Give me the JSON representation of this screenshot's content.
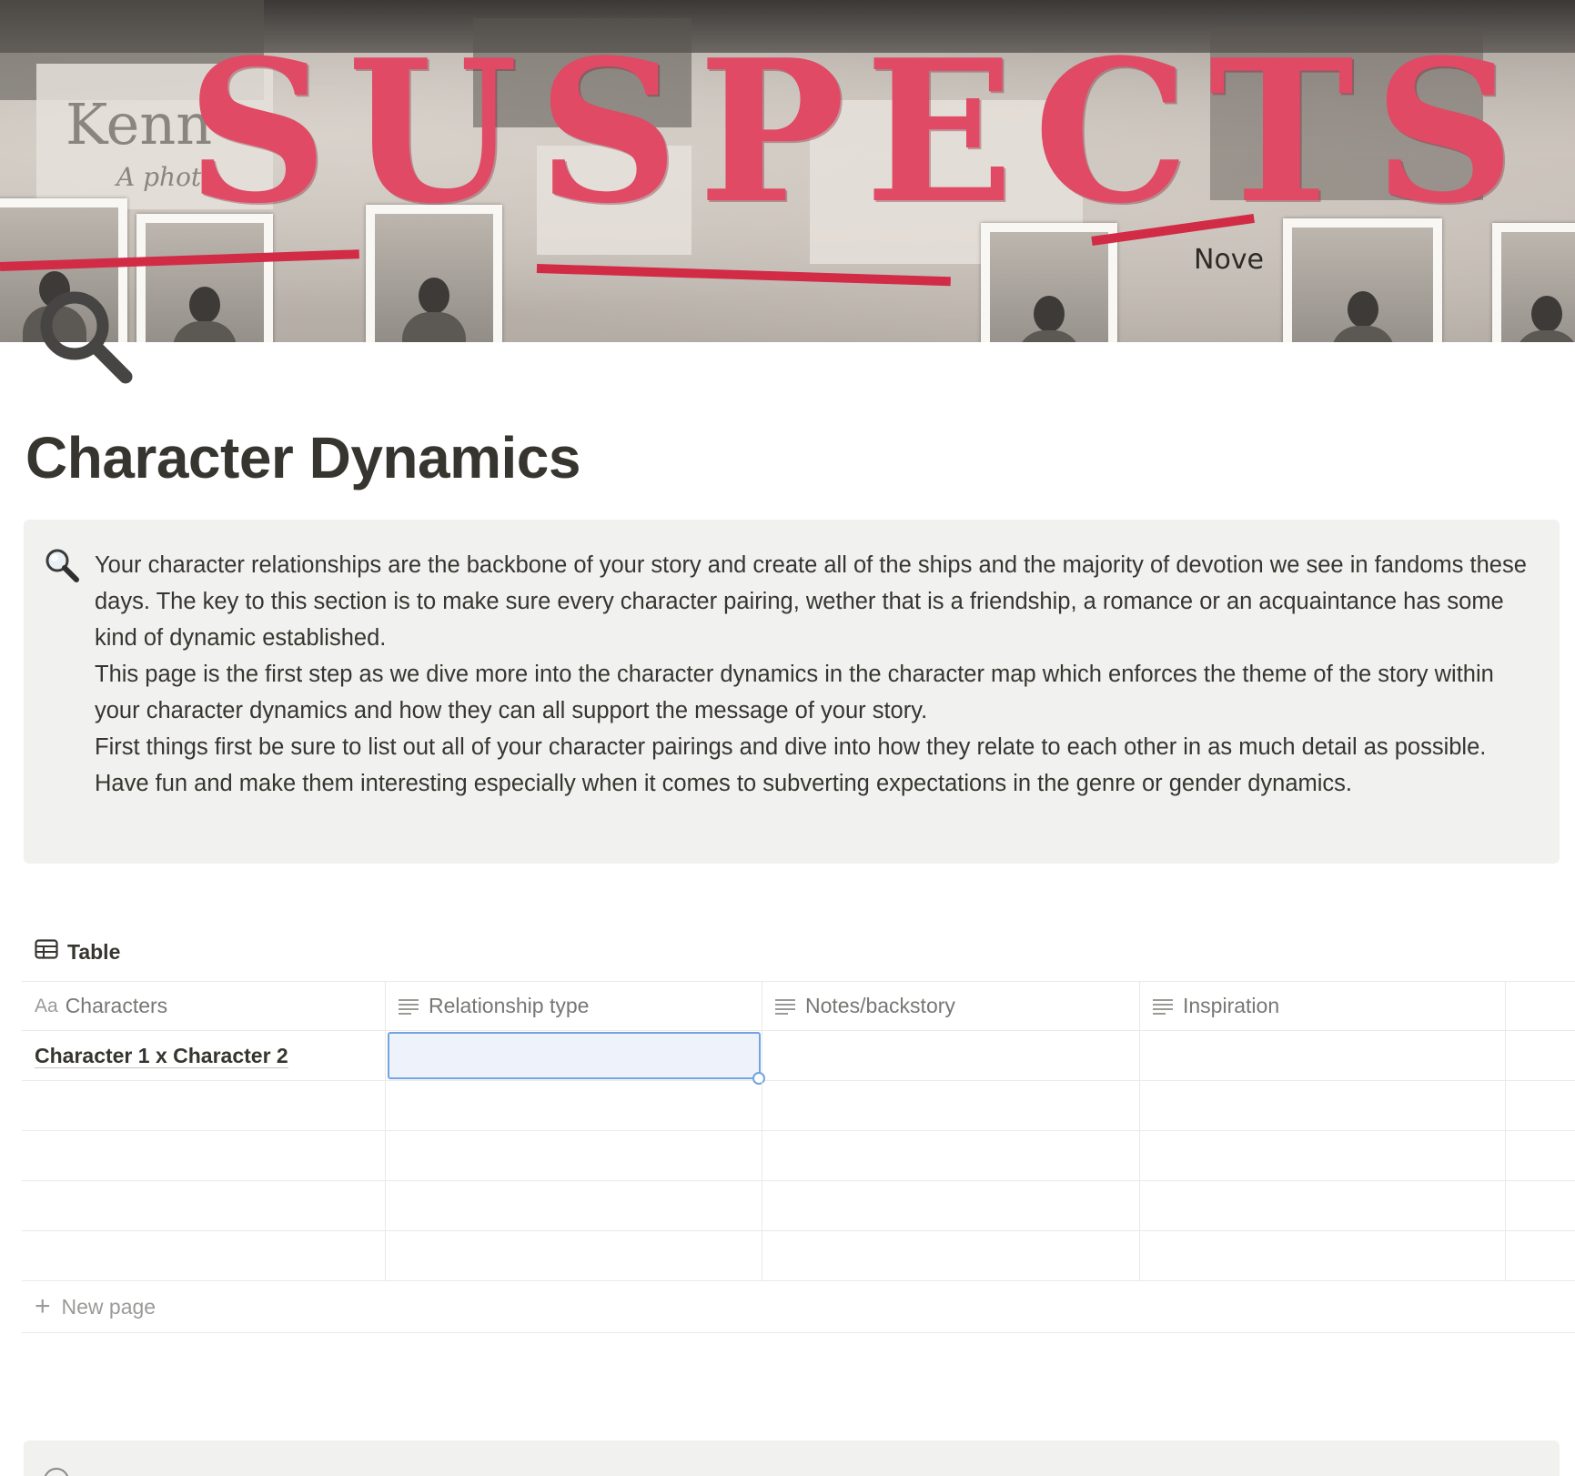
{
  "cover": {
    "headline_letters": [
      "S",
      "U",
      "S",
      "P",
      "E",
      "C",
      "T",
      "S"
    ],
    "scrap_texts": [
      "Kenn",
      "A photo",
      "Nove"
    ],
    "accent_color": "#e04a64",
    "string_color": "#d22b45"
  },
  "page": {
    "icon": "magnifying-glass-icon",
    "title": "Character Dynamics"
  },
  "callout": {
    "icon": "magnifying-glass-tilted-icon",
    "paragraphs": [
      "Your character relationships are the backbone of your story and create all of the ships and the majority of devotion we see in fandoms these days. The key to this section is to make sure every character pairing, wether that is a friendship, a romance or an acquaintance has some kind of dynamic established.",
      "This page is the first step as we dive more into the character dynamics in the character map which enforces the theme of the story within your character dynamics and how they can all support the message of your story.",
      "First things first be sure to list out all of your character pairings and dive into how they relate to each other in as much detail as possible. Have fun and make them interesting especially when it comes to subverting expectations in the genre or gender dynamics."
    ]
  },
  "database": {
    "view_label": "Table",
    "title_prefix": "Aa",
    "columns": [
      {
        "label": "Characters",
        "icon": "title-property-icon"
      },
      {
        "label": "Relationship type",
        "icon": "text-property-icon"
      },
      {
        "label": "Notes/backstory",
        "icon": "text-property-icon"
      },
      {
        "label": "Inspiration",
        "icon": "text-property-icon"
      }
    ],
    "rows": [
      {
        "title": "Character 1 x Character 2",
        "relationship_type": "",
        "notes": "",
        "inspiration": ""
      }
    ],
    "new_page_label": "New page",
    "selection_color": "#74a3e3"
  }
}
